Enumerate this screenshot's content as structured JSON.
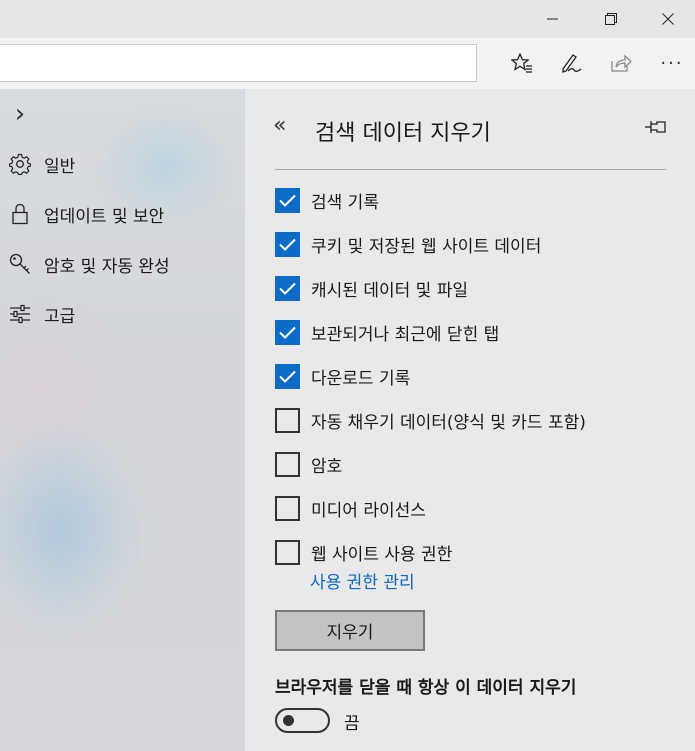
{
  "window": {
    "controls": [
      "minimize-icon",
      "restore-icon",
      "close-icon"
    ]
  },
  "toolbar": {
    "address_value": "",
    "buttons": [
      "favorites-icon",
      "pen-icon",
      "share-icon",
      "more-icon"
    ],
    "more_label": "···"
  },
  "sidebar": {
    "expand_glyph": "›",
    "items": [
      {
        "label": "일반",
        "icon": "gear-icon"
      },
      {
        "label": "업데이트 및 보안",
        "icon": "lock-icon"
      },
      {
        "label": "암호 및 자동 완성",
        "icon": "key-icon"
      },
      {
        "label": "고급",
        "icon": "sliders-icon"
      }
    ]
  },
  "panel": {
    "back_glyph": "«",
    "title": "검색 데이터 지우기",
    "pin_icon": "pin-icon",
    "checkboxes": [
      {
        "label": "검색 기록",
        "checked": true
      },
      {
        "label": "쿠키 및 저장된 웹 사이트 데이터",
        "checked": true
      },
      {
        "label": "캐시된 데이터 및 파일",
        "checked": true
      },
      {
        "label": "보관되거나 최근에 닫힌 탭",
        "checked": true
      },
      {
        "label": "다운로드 기록",
        "checked": true
      },
      {
        "label": "자동 채우기 데이터(양식 및 카드 포함)",
        "checked": false
      },
      {
        "label": "암호",
        "checked": false
      },
      {
        "label": "미디어 라이선스",
        "checked": false
      },
      {
        "label": "웹 사이트 사용 권한",
        "checked": false
      }
    ],
    "manage_link": "사용 권한 관리",
    "clear_button": "지우기",
    "always_clear_label": "브라우저를 닫을 때 항상 이 데이터 지우기",
    "toggle_state": "끔"
  },
  "colors": {
    "accent": "#0a6cc7",
    "link": "#0a67c4",
    "panel_bg": "#e9e9e9",
    "titlebar_bg": "#e6e6e6"
  }
}
